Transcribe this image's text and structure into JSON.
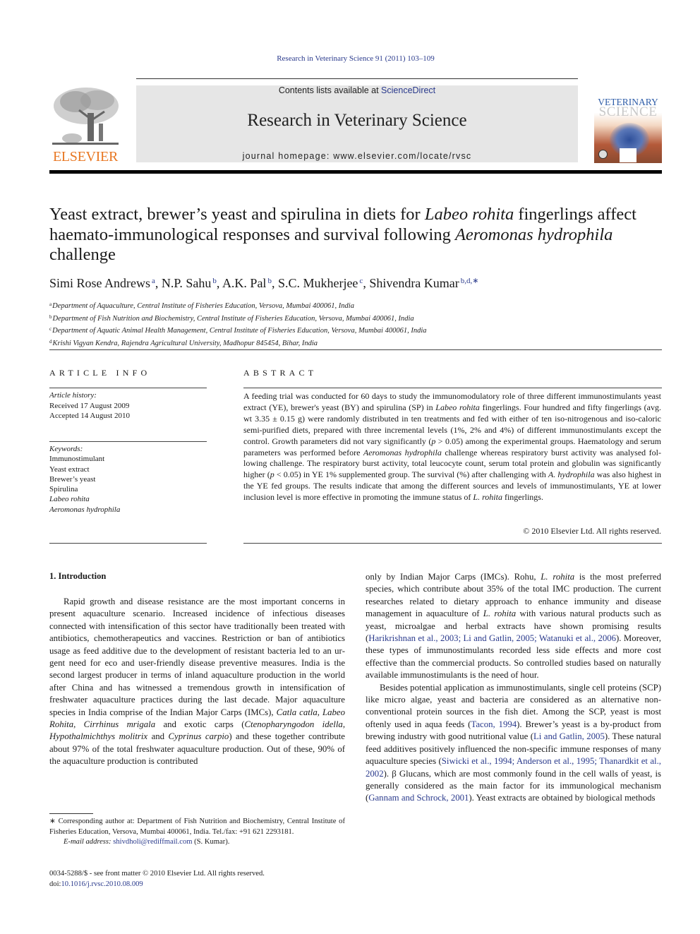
{
  "running_head": "Research in Veterinary Science 91 (2011) 103–109",
  "masthead": {
    "publisher_logo_text": "ELSEVIER",
    "contents_prefix": "Contents lists available at ",
    "contents_link": "ScienceDirect",
    "journal_title": "Research in Veterinary Science",
    "homepage": "journal homepage: www.elsevier.com/locate/rvsc",
    "cover": {
      "line1": "VETERINARY",
      "line2": "SCIENCE"
    },
    "colors": {
      "publisher_orange": "#e87722",
      "link_blue": "#2a3a8c",
      "banner_gray": "#e6e6e6"
    }
  },
  "article": {
    "title_parts": [
      {
        "text": "Yeast extract, brewer’s yeast and spirulina in diets for ",
        "italic": false
      },
      {
        "text": "Labeo rohita",
        "italic": true
      },
      {
        "text": " fingerlings affect haemato-immunological responses and survival following ",
        "italic": false
      },
      {
        "text": "Aeromonas hydrophila",
        "italic": true
      },
      {
        "text": " challenge",
        "italic": false
      }
    ],
    "authors": [
      {
        "name": "Simi Rose Andrews",
        "affil": "a"
      },
      {
        "name": "N.P. Sahu",
        "affil": "b"
      },
      {
        "name": "A.K. Pal",
        "affil": "b"
      },
      {
        "name": "S.C. Mukherjee",
        "affil": "c"
      },
      {
        "name": "Shivendra Kumar",
        "affil": "b,d,∗"
      }
    ],
    "affiliations": [
      {
        "key": "a",
        "text": "Department of Aquaculture, Central Institute of Fisheries Education, Versova, Mumbai 400061, India"
      },
      {
        "key": "b",
        "text": "Department of Fish Nutrition and Biochemistry, Central Institute of Fisheries Education, Versova, Mumbai 400061, India"
      },
      {
        "key": "c",
        "text": "Department of Aquatic Animal Health Management, Central Institute of Fisheries Education, Versova, Mumbai 400061, India"
      },
      {
        "key": "d",
        "text": "Krishi Vigyan Kendra, Rajendra Agricultural University, Madhopur 845454, Bihar, India"
      }
    ]
  },
  "article_info": {
    "heading": "ARTICLE INFO",
    "history_label": "Article history:",
    "received": "Received 17 August 2009",
    "accepted": "Accepted 14 August 2010",
    "keywords_label": "Keywords:",
    "keywords": [
      {
        "text": "Immunostimulant",
        "italic": false
      },
      {
        "text": "Yeast extract",
        "italic": false
      },
      {
        "text": "Brewer’s yeast",
        "italic": false
      },
      {
        "text": "Spirulina",
        "italic": false
      },
      {
        "text": "Labeo rohita",
        "italic": true
      },
      {
        "text": "Aeromonas hydrophila",
        "italic": true
      }
    ]
  },
  "abstract": {
    "heading": "ABSTRACT",
    "parts": [
      {
        "text": "A feeding trial was conducted for 60 days to study the immunomodulatory role of three different immu­nostimulants yeast extract (YE), brewer's yeast (BY) and spirulina (SP) in ",
        "italic": false
      },
      {
        "text": "Labeo rohita",
        "italic": true
      },
      {
        "text": " fingerlings. Four hundred and fifty fingerlings (avg. wt 3.35 ± 0.15 g) were randomly distributed in ten treatments and fed with either of ten iso-nitrogenous and iso-caloric semi-purified diets, prepared with three incremen­tal levels (1%, 2% and 4%) of different immunostimulants except the control. Growth parameters did not vary significantly (",
        "italic": false
      },
      {
        "text": "p",
        "italic": true
      },
      {
        "text": " > 0.05) among the experimental groups. Haematology and serum parameters was performed before ",
        "italic": false
      },
      {
        "text": "Aeromonas hydrophila",
        "italic": true
      },
      {
        "text": " challenge whereas respiratory burst activity was analysed fol­lowing challenge. The respiratory burst activity, total leucocyte count, serum total protein and globulin was significantly higher (",
        "italic": false
      },
      {
        "text": "p",
        "italic": true
      },
      {
        "text": " < 0.05) in YE 1% supplemented group. The survival (%) after challenging with ",
        "italic": false
      },
      {
        "text": "A. hydrophila",
        "italic": true
      },
      {
        "text": " was also highest in the YE fed groups. The results indicate that among the different sources and levels of immunostimulants, YE at lower inclusion level is more effective in promoting the immune status of ",
        "italic": false
      },
      {
        "text": "L. rohita",
        "italic": true
      },
      {
        "text": " fingerlings.",
        "italic": false
      }
    ],
    "copyright": "© 2010 Elsevier Ltd. All rights reserved."
  },
  "body": {
    "section_heading": "1. Introduction",
    "left_column": [
      {
        "text": "Rapid growth and disease resistance are the most important concerns in present aquaculture scenario. Increased incidence of infectious diseases connected with intensification of this sector have traditionally been treated with antibiotics, chemotherapeu­tics and vaccines. Restriction or ban of antibiotics usage as feed additive due to the development of resistant bacteria led to an ur­gent need for eco and user-friendly disease preventive measures. India is the second largest producer in terms of inland aquaculture production in the world after China and has witnessed a tremen­dous growth in intensification of freshwater aquaculture practices during the last decade. Major aquaculture species in India com­prise of the Indian Major Carps (IMCs), ",
        "style": "normal"
      },
      {
        "text": "Catla catla",
        "style": "italic"
      },
      {
        "text": ", ",
        "style": "normal"
      },
      {
        "text": "Labeo Rohita",
        "style": "italic"
      },
      {
        "text": ", ",
        "style": "normal"
      },
      {
        "text": "Cir­rhinus mrigala",
        "style": "italic"
      },
      {
        "text": " and exotic carps (",
        "style": "normal"
      },
      {
        "text": "Ctenopharyngodon idella",
        "style": "italic"
      },
      {
        "text": ", ",
        "style": "normal"
      },
      {
        "text": "Hypothalmichthys molitrix",
        "style": "italic"
      },
      {
        "text": " and ",
        "style": "normal"
      },
      {
        "text": "Cyprinus carpio",
        "style": "italic"
      },
      {
        "text": ") and these together contribute about 97% of the total freshwater aquaculture produc­tion. Out of these, 90% of the aquaculture production is contributed",
        "style": "normal"
      }
    ],
    "right_paragraph_1": [
      {
        "text": "only by Indian Major Carps (IMCs). Rohu, ",
        "style": "normal"
      },
      {
        "text": "L. rohita",
        "style": "italic"
      },
      {
        "text": " is the most pre­ferred species, which contribute about 35% of the total IMC produc­tion. The current researches related to dietary approach to enhance immunity and disease management in aquaculture of ",
        "style": "normal"
      },
      {
        "text": "L. rohita",
        "style": "italic"
      },
      {
        "text": " with various natural products such as yeast, microalgae and herbal ex­tracts have shown promising results (",
        "style": "normal"
      },
      {
        "text": "Harikrishnan et al., 2003; Li and Gatlin, 2005; Watanuki et al., 2006",
        "style": "link"
      },
      {
        "text": "). Moreover, these types of immunostimulants recorded less side effects and more cost effective than the commercial products. So controlled studies based on naturally available immunostimulants is the need of hour.",
        "style": "normal"
      }
    ],
    "right_paragraph_2": [
      {
        "text": "Besides potential application as immunostimulants, single cell proteins (SCP) like micro algae, yeast and bacteria are considered as an alternative non-conventional protein sources in the fish diet. Among the SCP, yeast is most oftenly used in aqua feeds (",
        "style": "normal"
      },
      {
        "text": "Tacon, 1994",
        "style": "link"
      },
      {
        "text": "). Brewer’s yeast is a by-product from brewing industry with good nutritional value (",
        "style": "normal"
      },
      {
        "text": "Li and Gatlin, 2005",
        "style": "link"
      },
      {
        "text": "). These natural feed additives positively influenced the non-specific immune responses of many aquaculture species (",
        "style": "normal"
      },
      {
        "text": "Siwicki et al., 1994; Anderson et al., 1995; Thanardkit et al., 2002",
        "style": "link"
      },
      {
        "text": "). β Glucans, which are most com­monly found in the cell walls of yeast, is generally considered as the main factor for its immunological mechanism (",
        "style": "normal"
      },
      {
        "text": "Gannam and Schrock, 2001",
        "style": "link"
      },
      {
        "text": "). Yeast extracts are obtained by biological methods",
        "style": "normal"
      }
    ]
  },
  "footnote": {
    "corresponding": "∗ Corresponding author at: Department of Fish Nutrition and Biochemistry, Central Institute of Fisheries Education, Versova, Mumbai 400061, India. Tel./fax: +91 621 2293181.",
    "email_label": "E-mail address:",
    "email": "shivdholi@rediffmail.com",
    "email_suffix": " (S. Kumar).",
    "front_matter": "0034-5288/$ - see front matter © 2010 Elsevier Ltd. All rights reserved.",
    "doi_prefix": "doi:",
    "doi": "10.1016/j.rvsc.2010.08.009"
  }
}
